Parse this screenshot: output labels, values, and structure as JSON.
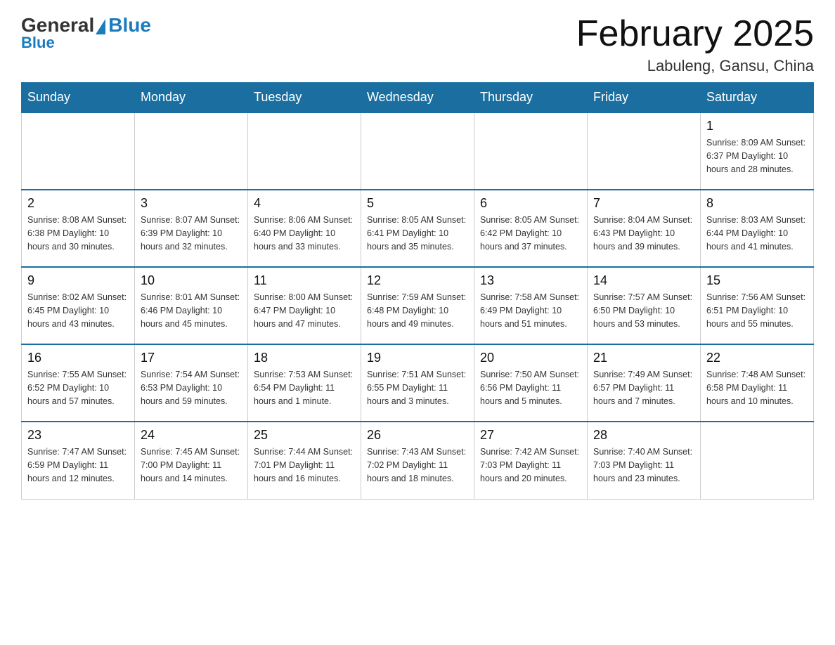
{
  "logo": {
    "general": "General",
    "blue": "Blue"
  },
  "title": "February 2025",
  "location": "Labuleng, Gansu, China",
  "days_header": [
    "Sunday",
    "Monday",
    "Tuesday",
    "Wednesday",
    "Thursday",
    "Friday",
    "Saturday"
  ],
  "weeks": [
    [
      {
        "day": "",
        "info": ""
      },
      {
        "day": "",
        "info": ""
      },
      {
        "day": "",
        "info": ""
      },
      {
        "day": "",
        "info": ""
      },
      {
        "day": "",
        "info": ""
      },
      {
        "day": "",
        "info": ""
      },
      {
        "day": "1",
        "info": "Sunrise: 8:09 AM\nSunset: 6:37 PM\nDaylight: 10 hours\nand 28 minutes."
      }
    ],
    [
      {
        "day": "2",
        "info": "Sunrise: 8:08 AM\nSunset: 6:38 PM\nDaylight: 10 hours\nand 30 minutes."
      },
      {
        "day": "3",
        "info": "Sunrise: 8:07 AM\nSunset: 6:39 PM\nDaylight: 10 hours\nand 32 minutes."
      },
      {
        "day": "4",
        "info": "Sunrise: 8:06 AM\nSunset: 6:40 PM\nDaylight: 10 hours\nand 33 minutes."
      },
      {
        "day": "5",
        "info": "Sunrise: 8:05 AM\nSunset: 6:41 PM\nDaylight: 10 hours\nand 35 minutes."
      },
      {
        "day": "6",
        "info": "Sunrise: 8:05 AM\nSunset: 6:42 PM\nDaylight: 10 hours\nand 37 minutes."
      },
      {
        "day": "7",
        "info": "Sunrise: 8:04 AM\nSunset: 6:43 PM\nDaylight: 10 hours\nand 39 minutes."
      },
      {
        "day": "8",
        "info": "Sunrise: 8:03 AM\nSunset: 6:44 PM\nDaylight: 10 hours\nand 41 minutes."
      }
    ],
    [
      {
        "day": "9",
        "info": "Sunrise: 8:02 AM\nSunset: 6:45 PM\nDaylight: 10 hours\nand 43 minutes."
      },
      {
        "day": "10",
        "info": "Sunrise: 8:01 AM\nSunset: 6:46 PM\nDaylight: 10 hours\nand 45 minutes."
      },
      {
        "day": "11",
        "info": "Sunrise: 8:00 AM\nSunset: 6:47 PM\nDaylight: 10 hours\nand 47 minutes."
      },
      {
        "day": "12",
        "info": "Sunrise: 7:59 AM\nSunset: 6:48 PM\nDaylight: 10 hours\nand 49 minutes."
      },
      {
        "day": "13",
        "info": "Sunrise: 7:58 AM\nSunset: 6:49 PM\nDaylight: 10 hours\nand 51 minutes."
      },
      {
        "day": "14",
        "info": "Sunrise: 7:57 AM\nSunset: 6:50 PM\nDaylight: 10 hours\nand 53 minutes."
      },
      {
        "day": "15",
        "info": "Sunrise: 7:56 AM\nSunset: 6:51 PM\nDaylight: 10 hours\nand 55 minutes."
      }
    ],
    [
      {
        "day": "16",
        "info": "Sunrise: 7:55 AM\nSunset: 6:52 PM\nDaylight: 10 hours\nand 57 minutes."
      },
      {
        "day": "17",
        "info": "Sunrise: 7:54 AM\nSunset: 6:53 PM\nDaylight: 10 hours\nand 59 minutes."
      },
      {
        "day": "18",
        "info": "Sunrise: 7:53 AM\nSunset: 6:54 PM\nDaylight: 11 hours\nand 1 minute."
      },
      {
        "day": "19",
        "info": "Sunrise: 7:51 AM\nSunset: 6:55 PM\nDaylight: 11 hours\nand 3 minutes."
      },
      {
        "day": "20",
        "info": "Sunrise: 7:50 AM\nSunset: 6:56 PM\nDaylight: 11 hours\nand 5 minutes."
      },
      {
        "day": "21",
        "info": "Sunrise: 7:49 AM\nSunset: 6:57 PM\nDaylight: 11 hours\nand 7 minutes."
      },
      {
        "day": "22",
        "info": "Sunrise: 7:48 AM\nSunset: 6:58 PM\nDaylight: 11 hours\nand 10 minutes."
      }
    ],
    [
      {
        "day": "23",
        "info": "Sunrise: 7:47 AM\nSunset: 6:59 PM\nDaylight: 11 hours\nand 12 minutes."
      },
      {
        "day": "24",
        "info": "Sunrise: 7:45 AM\nSunset: 7:00 PM\nDaylight: 11 hours\nand 14 minutes."
      },
      {
        "day": "25",
        "info": "Sunrise: 7:44 AM\nSunset: 7:01 PM\nDaylight: 11 hours\nand 16 minutes."
      },
      {
        "day": "26",
        "info": "Sunrise: 7:43 AM\nSunset: 7:02 PM\nDaylight: 11 hours\nand 18 minutes."
      },
      {
        "day": "27",
        "info": "Sunrise: 7:42 AM\nSunset: 7:03 PM\nDaylight: 11 hours\nand 20 minutes."
      },
      {
        "day": "28",
        "info": "Sunrise: 7:40 AM\nSunset: 7:03 PM\nDaylight: 11 hours\nand 23 minutes."
      },
      {
        "day": "",
        "info": ""
      }
    ]
  ]
}
